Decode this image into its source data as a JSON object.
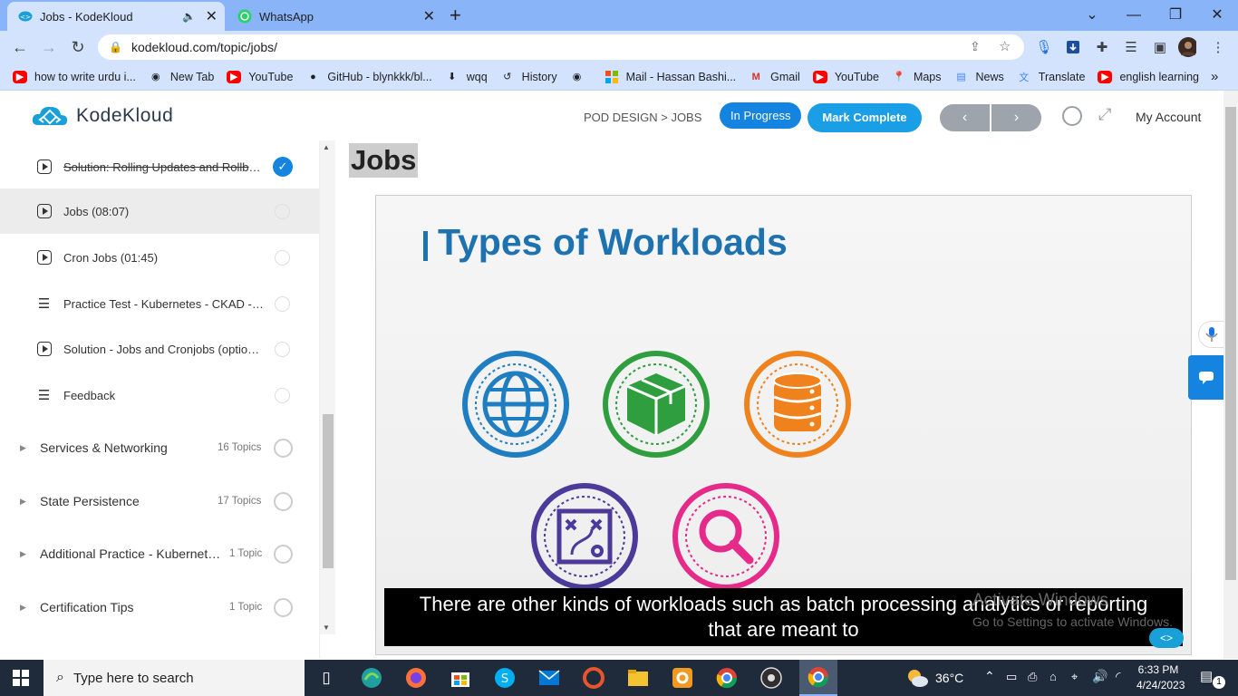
{
  "browser": {
    "tabs": [
      {
        "title": "Jobs - KodeKloud",
        "active": true
      },
      {
        "title": "WhatsApp",
        "active": false
      }
    ],
    "new_tab": "+",
    "url": "kodekloud.com/topic/jobs/",
    "bookmarks": [
      {
        "label": "how to write urdu i...",
        "icon": "youtube-icon"
      },
      {
        "label": "New Tab",
        "icon": "globe-icon"
      },
      {
        "label": "YouTube",
        "icon": "youtube-icon"
      },
      {
        "label": "GitHub - blynkkk/bl...",
        "icon": "github-icon"
      },
      {
        "label": "wqq",
        "icon": "download-icon"
      },
      {
        "label": "History",
        "icon": "history-icon"
      },
      {
        "label": "",
        "icon": "globe-icon"
      },
      {
        "label": "Mail - Hassan Bashi...",
        "icon": "microsoft-icon"
      },
      {
        "label": "Gmail",
        "icon": "gmail-icon"
      },
      {
        "label": "YouTube",
        "icon": "youtube-icon"
      },
      {
        "label": "Maps",
        "icon": "maps-icon"
      },
      {
        "label": "News",
        "icon": "news-icon"
      },
      {
        "label": "Translate",
        "icon": "translate-icon"
      },
      {
        "label": "english learning",
        "icon": "youtube-icon"
      }
    ],
    "more": "»"
  },
  "header": {
    "logo_text": "KodeKloud",
    "breadcrumb": "POD DESIGN > JOBS",
    "status_button": "In Progress",
    "complete_button": "Mark Complete",
    "prev": "‹",
    "next": "›",
    "account": "My Account"
  },
  "sidebar": {
    "lessons": [
      {
        "label": "Solution: Rolling Updates and Rollbacks",
        "icon": "play-icon",
        "done": true
      },
      {
        "label": "Jobs (08:07)",
        "icon": "play-icon",
        "done": false,
        "current": true
      },
      {
        "label": "Cron Jobs (01:45)",
        "icon": "play-icon",
        "done": false
      },
      {
        "label": "Practice Test - Kubernetes - CKAD - Jobs and Cronjobs",
        "icon": "list-icon",
        "done": false
      },
      {
        "label": "Solution - Jobs and Cronjobs (optional)",
        "icon": "play-icon",
        "done": false
      },
      {
        "label": "Feedback",
        "icon": "list-icon",
        "done": false
      }
    ],
    "sections": [
      {
        "label": "Services & Networking",
        "count": "16 Topics"
      },
      {
        "label": "State Persistence",
        "count": "17 Topics"
      },
      {
        "label": "Additional Practice - Kubernetes for the Absolute Beginners",
        "count": "1 Topic"
      },
      {
        "label": "Certification Tips",
        "count": "1 Topic"
      }
    ]
  },
  "main": {
    "title": "Jobs",
    "slide_title": "Types of Workloads",
    "subtitle_line1": "There are other kinds of workloads such as batch processing analytics or reporting",
    "subtitle_line2": "that are meant to",
    "activate_line1": "Activate Windows",
    "activate_line2": "Go to Settings to activate Windows."
  },
  "taskbar": {
    "search_placeholder": "Type here to search",
    "weather": "36°C",
    "time": "6:33 PM",
    "date": "4/24/2023",
    "notifications": "1"
  },
  "colors": {
    "accent": "#1584e0",
    "slide_blue": "#1f72b0",
    "green": "#2e9e3f",
    "orange": "#f0821e",
    "purple": "#4b3a9a",
    "pink": "#e52a8a"
  }
}
